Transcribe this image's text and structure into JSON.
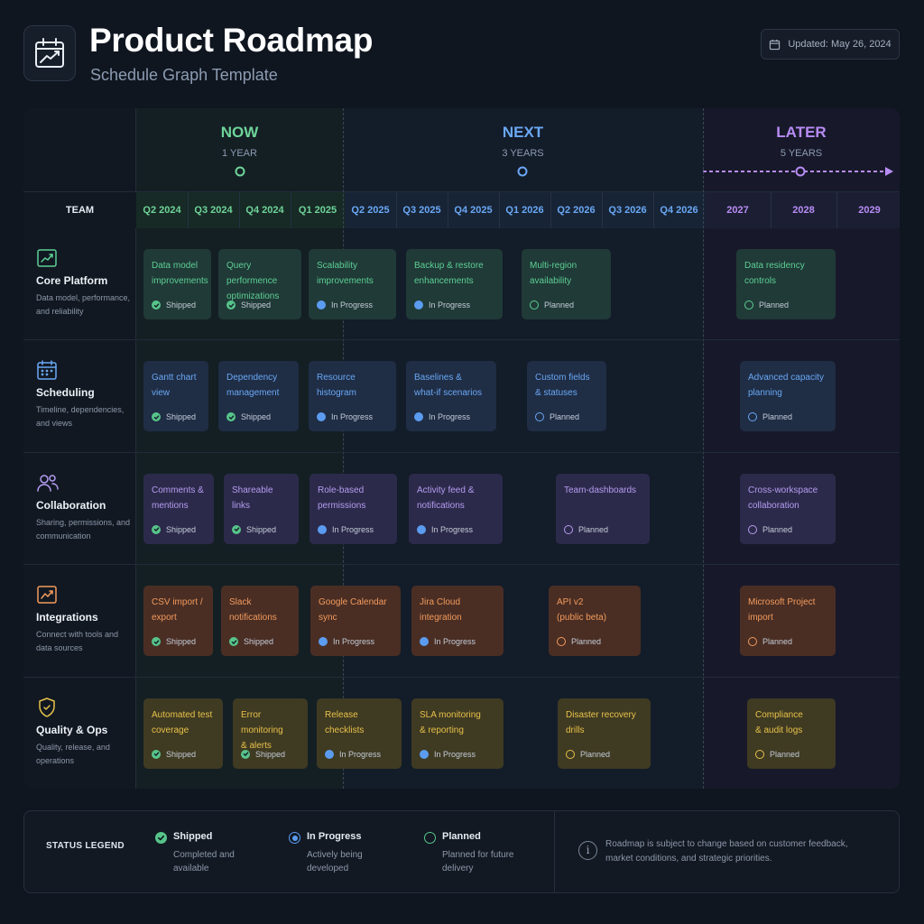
{
  "header": {
    "title": "Product Roadmap",
    "subtitle": "Schedule Graph Template",
    "updated": "Updated: May 26, 2024"
  },
  "phases": [
    {
      "label": "NOW",
      "duration": "1 YEAR",
      "color": "#6fd49a"
    },
    {
      "label": "NEXT",
      "duration": "3 YEARS",
      "color": "#6aa8f5"
    },
    {
      "label": "LATER",
      "duration": "5 YEARS",
      "color": "#b88cf5"
    }
  ],
  "columns": {
    "team_header": "TEAM",
    "periods": [
      "Q2 2024",
      "Q3 2024",
      "Q4 2024",
      "Q1 2025",
      "Q2 2025",
      "Q3 2025",
      "Q4 2025",
      "Q1 2026",
      "Q2 2026",
      "Q3 2026",
      "Q4 2026",
      "2027",
      "2028",
      "2029"
    ]
  },
  "teams": [
    {
      "name": "Core Platform",
      "desc": "Data model, performance, and reliability",
      "color": "#5ccf94",
      "icon": "chart-icon",
      "items": [
        {
          "title": "Data model\nimprovements",
          "status": "Shipped"
        },
        {
          "title": "Query performence\noptimizations",
          "status": "Shipped"
        },
        {
          "title": "Scalability\nimprovements",
          "status": "In Progress"
        },
        {
          "title": "Backup & restore\nenhancements",
          "status": "In Progress"
        },
        {
          "title": "Multi-region\navailability",
          "status": "Planned"
        },
        {
          "title": "Data residency\ncontrols",
          "status": "Planned"
        }
      ]
    },
    {
      "name": "Scheduling",
      "desc": "Timeline, dependencies, and views",
      "color": "#6aa8f5",
      "icon": "calendar-icon",
      "items": [
        {
          "title": "Gantt chart\nview",
          "status": "Shipped"
        },
        {
          "title": "Dependency\nmanagement",
          "status": "Shipped"
        },
        {
          "title": "Resource\nhistogram",
          "status": "In Progress"
        },
        {
          "title": "Baselines &\nwhat-if scenarios",
          "status": "In Progress"
        },
        {
          "title": "Custom fields\n& statuses",
          "status": "Planned"
        },
        {
          "title": "Advanced capacity\nplanning",
          "status": "Planned"
        }
      ]
    },
    {
      "name": "Collaboration",
      "desc": "Sharing, permissions, and communication",
      "color": "#b59cf2",
      "icon": "users-icon",
      "items": [
        {
          "title": "Comments &\nmentions",
          "status": "Shipped"
        },
        {
          "title": "Shareable\nlinks",
          "status": "Shipped"
        },
        {
          "title": "Role-based\npermissions",
          "status": "In Progress"
        },
        {
          "title": "Activity feed &\nnotifications",
          "status": "In Progress"
        },
        {
          "title": "Team-dashboards",
          "status": "Planned"
        },
        {
          "title": "Cross-workspace\ncollaboration",
          "status": "Planned"
        }
      ]
    },
    {
      "name": "Integrations",
      "desc": "Connect with tools and data sources",
      "color": "#f39a5c",
      "icon": "integration-icon",
      "items": [
        {
          "title": "CSV import /\nexport",
          "status": "Shipped"
        },
        {
          "title": "Slack\nnotifications",
          "status": "Shipped"
        },
        {
          "title": "Google Calendar\nsync",
          "status": "In Progress"
        },
        {
          "title": "Jira Cloud\nintegration",
          "status": "In Progress"
        },
        {
          "title": "API v2\n(public beta)",
          "status": "Planned"
        },
        {
          "title": "Microsoft Project\nimport",
          "status": "Planned"
        }
      ]
    },
    {
      "name": "Quality & Ops",
      "desc": "Quality, release, and operations",
      "color": "#e8c24a",
      "icon": "shield-icon",
      "items": [
        {
          "title": "Automated test\ncoverage",
          "status": "Shipped"
        },
        {
          "title": "Error monitoring\n& alerts",
          "status": "Shipped"
        },
        {
          "title": "Release\nchecklists",
          "status": "In Progress"
        },
        {
          "title": "SLA monitoring\n& reporting",
          "status": "In Progress"
        },
        {
          "title": "Disaster recovery\ndrills",
          "status": "Planned"
        },
        {
          "title": "Compliance\n& audit logs",
          "status": "Planned"
        }
      ]
    }
  ],
  "legend": {
    "title": "STATUS LEGEND",
    "items": [
      {
        "name": "Shipped",
        "desc": "Completed and available",
        "color": "#57c48a"
      },
      {
        "name": "In Progress",
        "desc": "Actively being developed",
        "color": "#5b9cf0"
      },
      {
        "name": "Planned",
        "desc": "Planned for future delivery",
        "color": "#57c48a"
      }
    ],
    "note": "Roadmap is subject to change based on customer feedback, market conditions, and strategic priorities."
  }
}
